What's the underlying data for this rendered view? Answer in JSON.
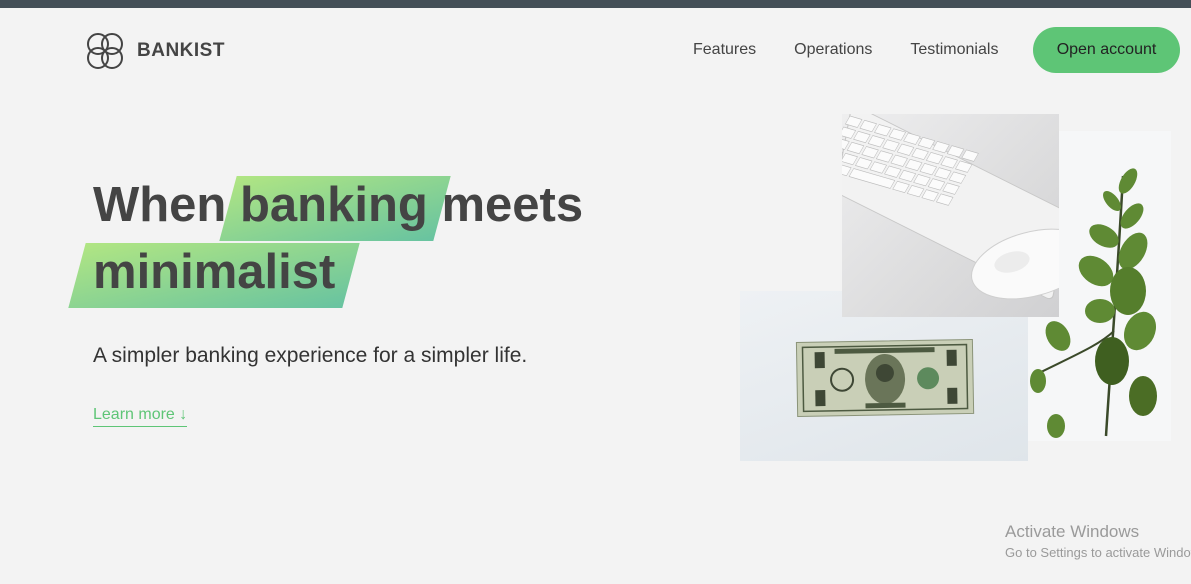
{
  "logo": {
    "text": "BANKIST",
    "icon": "interlocking-circles-logo"
  },
  "nav": {
    "items": [
      {
        "label": "Features"
      },
      {
        "label": "Operations"
      },
      {
        "label": "Testimonials"
      }
    ],
    "cta_label": "Open account"
  },
  "hero": {
    "title_part1": "When",
    "title_highlight1": "banking",
    "title_part2": "meets",
    "title_highlight2": "minimalist",
    "subtitle": "A simpler banking experience for a simpler life.",
    "learn_more": "Learn more ↓"
  },
  "images": {
    "keyboard": "keyboard-and-mouse-photo",
    "money": "dollar-bill-photo",
    "plant": "eucalyptus-plant-photo"
  },
  "colors": {
    "accent": "#5ec576",
    "gradient_start": "#9be15d",
    "gradient_end": "#39b385",
    "text": "#444444"
  },
  "watermark": {
    "line1": "Activate Windows",
    "line2": "Go to Settings to activate Windows."
  }
}
